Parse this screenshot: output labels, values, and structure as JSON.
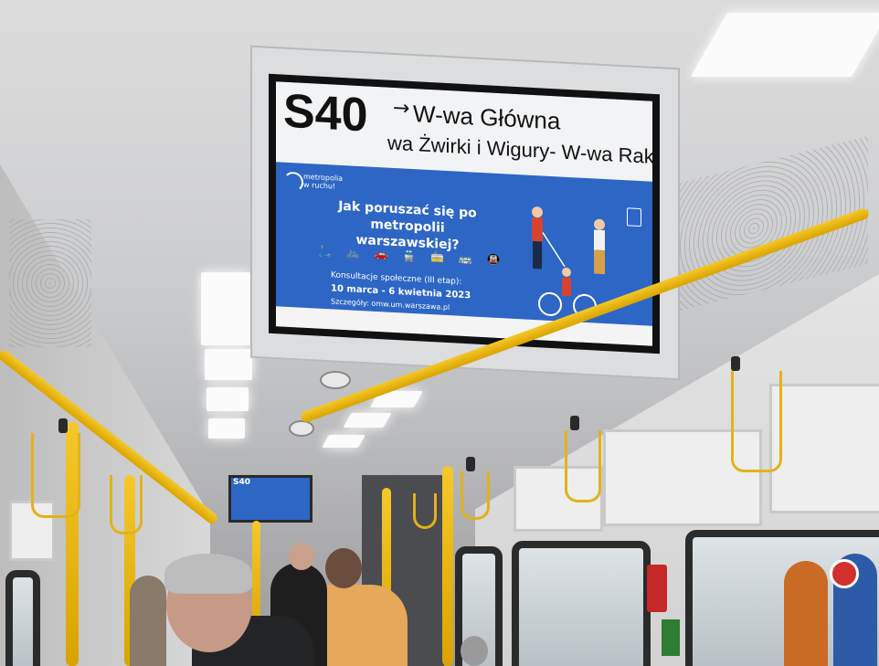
{
  "screen": {
    "route_number": "S40",
    "arrow": "→",
    "destination": "W-wa Główna",
    "stops_ticker": "wa Żwirki i Wigury- W-wa Rakow",
    "logo_text_line1": "metropolia",
    "logo_text_line2": "w ruchu!",
    "headline_line1": "Jak poruszać się po metropolii",
    "headline_line2": "warszawskiej?",
    "transport_icons": "🛴 🚲 🚗 🚆 🚋 🚌 🚇",
    "consultation": "Konsultacje społeczne (III etap):",
    "dates": "10 marca - 6 kwietnia 2023",
    "details": "Szczegóły: omw.um.warszawa.pl"
  },
  "small_screen": {
    "route_number": "S40"
  },
  "colors": {
    "screen_blue": "#2d66c5",
    "rail_yellow": "#f5c82a",
    "intercom_red": "#c62828",
    "exit_green": "#2e7d32"
  }
}
